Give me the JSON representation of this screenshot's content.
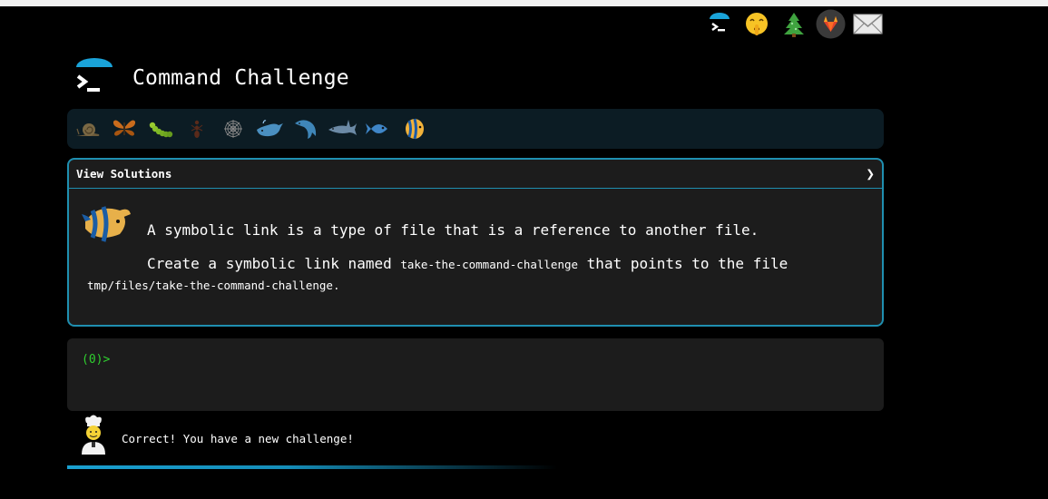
{
  "header": {
    "title": "Command Challenge"
  },
  "top_icons": [
    "terminal-icon",
    "shushing-face-icon",
    "tree-icon",
    "gitlab-icon",
    "mail-icon"
  ],
  "levels": [
    "snail-icon",
    "butterfly-icon",
    "caterpillar-icon",
    "ant-icon",
    "spider-web-icon",
    "whale-icon",
    "dolphin-icon",
    "shark-icon",
    "fish-icon",
    "tropical-fish-icon"
  ],
  "solutions_panel": {
    "label": "View Solutions",
    "chevron": "❯"
  },
  "challenge": {
    "intro": "A symbolic link is a type of file that is a reference to another file.",
    "task_prefix": "Create a symbolic link named",
    "link_name": "take-the-command-challenge",
    "task_middle": "that points to the file",
    "target_path": "tmp/files/take-the-command-challenge",
    "task_suffix": "."
  },
  "terminal": {
    "prompt": "(0)>"
  },
  "feedback": {
    "message": "Correct! You have a new challenge!"
  },
  "colors": {
    "accent": "#1f8fb0",
    "prompt": "#2fd02f",
    "background": "#000000",
    "panel": "#1c1c1c"
  }
}
